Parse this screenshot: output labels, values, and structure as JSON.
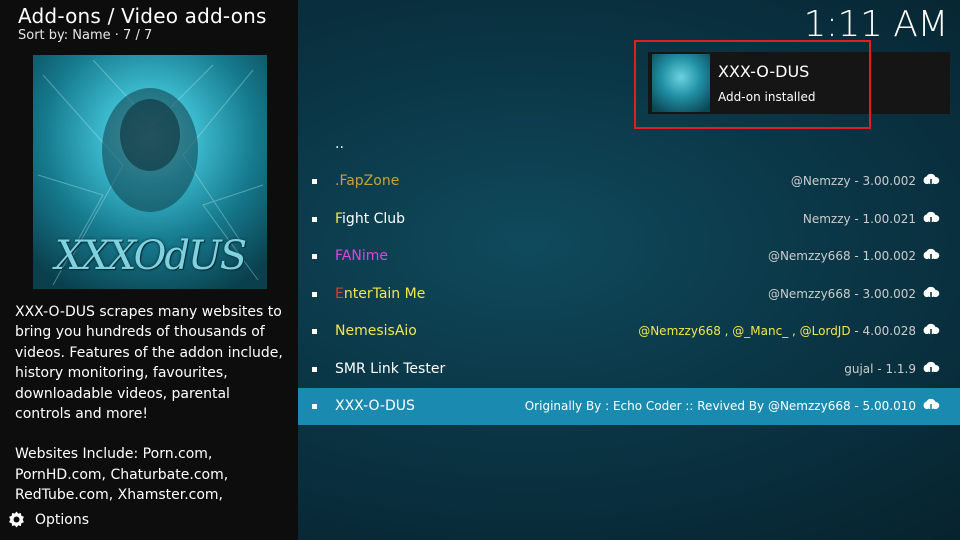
{
  "header": {
    "title": "Add-ons / Video add-ons",
    "subtitle": "Sort by: Name  ·  7 / 7"
  },
  "clock": "1:11 AM",
  "artwork": {
    "logo_text": "XXXOdUS"
  },
  "description": {
    "paragraph1": "XXX-O-DUS scrapes many websites to bring you hundreds of thousands of videos. Features of the addon include, history monitoring, favourites, downloadable videos, parental controls and more!",
    "paragraph2": "Websites Include: Porn.com, PornHD.com, Chaturbate.com, RedTube.com, Xhamster.com,"
  },
  "options_label": "Options",
  "notification": {
    "title": "XXX-O-DUS",
    "message": "Add-on installed"
  },
  "list": {
    "parent": "..",
    "items": [
      {
        "name": ".FapZone",
        "meta": "@Nemzzy - 3.00.002",
        "name_color": "#c8a235",
        "meta_color": "#cccccc"
      },
      {
        "name_first": "F",
        "name_rest": "ight Club",
        "meta": "Nemzzy - 1.00.021",
        "name_first_color": "#f2e64d",
        "name_rest_color": "#ffffff",
        "meta_color": "#cccccc"
      },
      {
        "name": "FANime",
        "meta": "@Nemzzy668 - 1.00.002",
        "name_color": "#e044e0",
        "meta_color": "#cccccc"
      },
      {
        "name_first": "E",
        "name_rest": "nterTain Me",
        "meta": "@Nemzzy668 - 3.00.002",
        "name_first_color": "#c84a2a",
        "name_rest_color": "#f2e64d",
        "meta_color": "#cccccc"
      },
      {
        "name": "NemesisAio",
        "meta_highlight": "@Nemzzy668 , @_Manc_ , @LordJD",
        "meta_rest": " - 4.00.028",
        "name_color": "#f2e64d",
        "meta_color": "#f2e64d"
      },
      {
        "name": "SMR Link Tester",
        "meta": "gujal - 1.1.9",
        "name_color": "#ffffff",
        "meta_color": "#cccccc"
      },
      {
        "name": "XXX-O-DUS",
        "meta": "Originally By : Echo Coder :: Revived By @Nemzzy668 - 5.00.010",
        "name_color": "#ffffff",
        "meta_color": "#ffffff",
        "selected": true
      }
    ]
  },
  "colors": {
    "selection": "#1a8ab0",
    "highlight_box": "#e02020",
    "left_panel": "#0d0d0d"
  },
  "icons": [
    "options-gear-icon",
    "download-cloud-icon"
  ]
}
